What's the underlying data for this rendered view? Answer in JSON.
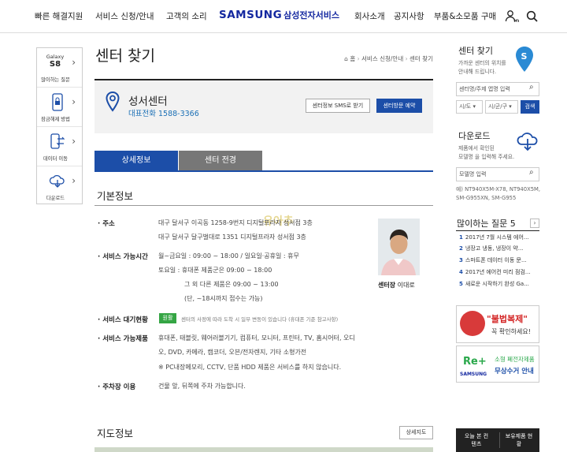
{
  "gnb": {
    "items": [
      "빠른 해결지원",
      "서비스 신청/안내",
      "고객의 소리",
      "회사소개",
      "공지사항",
      "부품&소모품 구매"
    ],
    "logo_word": "SAMSUNG",
    "logo_kor": "삼성전자서비스",
    "my_label": "MY"
  },
  "quick": {
    "items": [
      {
        "top": "Galaxy",
        "top2": "S8",
        "label": "많이하는 질문"
      },
      {
        "label": "잠금해제 방법"
      },
      {
        "label": "데이터 이동"
      },
      {
        "label": "다운로드"
      }
    ]
  },
  "page": {
    "title": "센터 찾기",
    "breadcrumb": [
      "홈",
      "서비스 신청/안내",
      "센터 찾기"
    ]
  },
  "center": {
    "name": "성서센터",
    "phone": "대표전화 1588-3366",
    "sms_btn": "센터정보 SMS로 받기",
    "visit_btn": "센터방문 예약"
  },
  "tabs": [
    "상세정보",
    "센터 전경"
  ],
  "basic": {
    "title": "기본정보",
    "address": {
      "label": "주소",
      "lines": [
        "대구 달서구 이곡동 1258-9번지 디지털프라자 성서점 3층",
        "대구 달서구 달구벌대로 1351 디지털프라자 성서점 3층"
      ]
    },
    "hours": {
      "label": "서비스 가능시간",
      "lines": [
        "월~금요일 : 09:00 ~ 18:00 / 일요일·공휴일 : 휴무",
        "토요일 : 휴대폰 제품군은 09:00 ~ 18:00",
        "그 외 다른 제품은 09:00 ~ 13:00",
        "(단, ~18시까지 접수는 가능)"
      ]
    },
    "wait": {
      "label": "서비스 대기현황",
      "badge": "원활",
      "note": "센터의 사정에 따라 도착 시 일부 변동이 있습니다 (휴대폰 기준 참고사항)"
    },
    "products": {
      "label": "서비스 가능제품",
      "lines": [
        "휴대폰, 태블릿, 웨어러블기기, 컴퓨터, 모니터, 프린터, TV, 홈시어터, 오디",
        "오, DVD, 카메라, 캠코더, 오븐/전자렌지, 기타 소형가전",
        "※ PC내장메모리, CCTV, 단품 HDD 제품은 서비스를 하지 않습니다."
      ]
    },
    "parking": {
      "label": "주차장 이용",
      "text": "건물 앞, 뒤쪽에 주차 가능합니다."
    },
    "staff": {
      "role": "센터장",
      "name": "이대로"
    },
    "watermark": "유아추"
  },
  "map": {
    "title": "지도정보",
    "btn": "상세지도"
  },
  "side": {
    "find": {
      "title": "센터 찾기",
      "desc": [
        "가까운 센터의 위치를",
        "안내해 드립니다."
      ],
      "search_ph": "센터명/주제 앱명 입력",
      "sel1": "시/도",
      "sel2": "시/군/구",
      "btn": "검색"
    },
    "download": {
      "title": "다운로드",
      "desc": [
        "제품에서 확인된",
        "모델명 을 입력해 주세요."
      ],
      "ph": "모델명 입력",
      "models": "예) NT940X5M-X78, NT940X5M,",
      "models2": "SM-G955XN, SM-G955"
    },
    "faq": {
      "title": "많이하는 질문 5",
      "items": [
        "2017년 7월 시스템 에어...",
        "냉장고 냉동, 냉장이 약...",
        "스마트폰 데이터 이동 문...",
        "2017년 에어컨 미리 점검...",
        "새로운 시작하기 완성 Ga..."
      ]
    },
    "banner1": {
      "title": "\"불법복제\"",
      "sub": "꼭 확인하세요!"
    },
    "banner2": {
      "title": "Re+",
      "brand": "SAMSUNG",
      "line1": "소형 폐전자제품",
      "line2": "무상수거 안내"
    },
    "bottom": [
      "오늘 본 컨텐츠",
      "보유제품 현황"
    ]
  }
}
